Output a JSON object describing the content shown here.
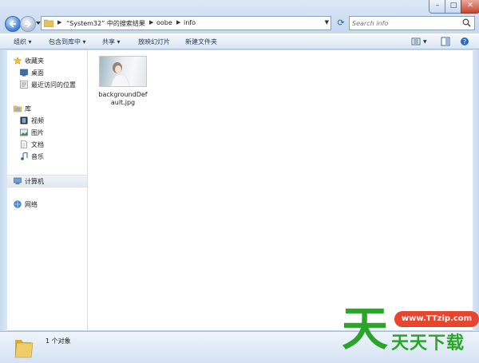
{
  "window": {
    "controls": {
      "minimize": "–",
      "maximize": "□",
      "close": "✕"
    }
  },
  "address_bar": {
    "crumbs": [
      "“System32” 中的搜索结果",
      "oobe",
      "info"
    ]
  },
  "search": {
    "placeholder": "Search info"
  },
  "toolbar": {
    "items": [
      "组织 ▾",
      "包含到库中 ▾",
      "共享 ▾",
      "放映幻灯片",
      "新建文件夹"
    ]
  },
  "nav_pane": {
    "favorites": {
      "label": "收藏夹",
      "items": [
        "桌面",
        "最近访问的位置"
      ]
    },
    "libraries": {
      "label": "库",
      "items": [
        "视频",
        "图片",
        "文档",
        "音乐"
      ]
    },
    "computer": {
      "label": "计算机"
    },
    "network": {
      "label": "网络"
    }
  },
  "files": [
    {
      "name": "backgroundDefault.jpg",
      "icon": "image-thumbnail-icon"
    }
  ],
  "status": {
    "text": "1 个对象"
  },
  "watermark": {
    "url": "www.TTzip.com",
    "brand": "天天下载",
    "glyph": "天"
  },
  "colors": {
    "accent": "#2aa52a",
    "badge": "#e6452e"
  }
}
